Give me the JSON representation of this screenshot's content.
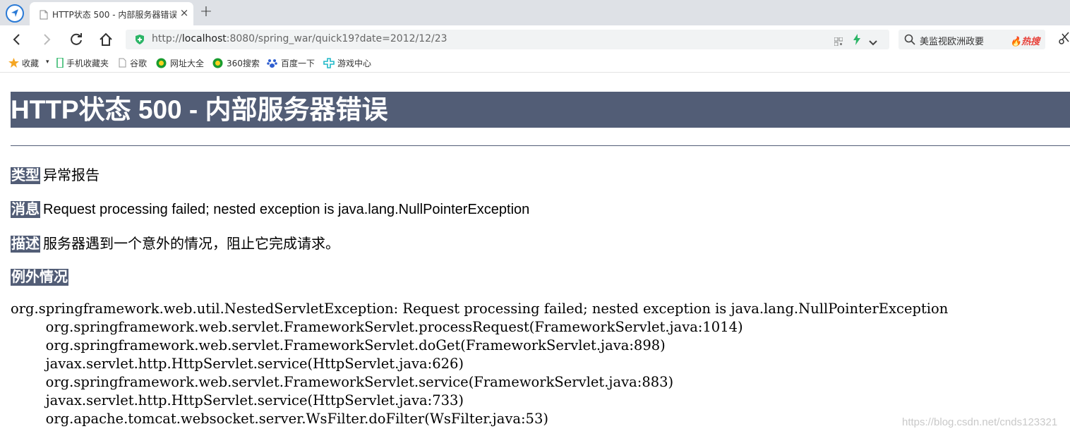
{
  "tab": {
    "title": "HTTP状态 500 - 内部服务器错误",
    "close": "×"
  },
  "new_tab": "+",
  "address": {
    "scheme": "http://",
    "host": "localhost",
    "rest": ":8080/spring_war/quick19?date=2012/12/23"
  },
  "search": {
    "text": "美监视欧洲政要",
    "hot": "🔥热搜"
  },
  "bookmarks": [
    {
      "label": "收藏",
      "icon": "star-icon"
    },
    {
      "label": "手机收藏夹",
      "icon": "phone-icon"
    },
    {
      "label": "谷歌",
      "icon": "doc-icon"
    },
    {
      "label": "网址大全",
      "icon": "360-icon"
    },
    {
      "label": "360搜索",
      "icon": "360-icon"
    },
    {
      "label": "百度一下",
      "icon": "baidu-paw-icon"
    },
    {
      "label": "游戏中心",
      "icon": "game-icon"
    }
  ],
  "page": {
    "heading": "HTTP状态 500 - 内部服务器错误",
    "type_label": "类型",
    "type_value": "异常报告",
    "message_label": "消息",
    "message_value": "Request processing failed; nested exception is java.lang.NullPointerException",
    "description_label": "描述",
    "description_value": "服务器遇到一个意外的情况，阻止它完成请求。",
    "exception_label": "例外情况",
    "stack_trace": [
      "org.springframework.web.util.NestedServletException: Request processing failed; nested exception is java.lang.NullPointerException",
      "\torg.springframework.web.servlet.FrameworkServlet.processRequest(FrameworkServlet.java:1014)",
      "\torg.springframework.web.servlet.FrameworkServlet.doGet(FrameworkServlet.java:898)",
      "\tjavax.servlet.http.HttpServlet.service(HttpServlet.java:626)",
      "\torg.springframework.web.servlet.FrameworkServlet.service(FrameworkServlet.java:883)",
      "\tjavax.servlet.http.HttpServlet.service(HttpServlet.java:733)",
      "\torg.apache.tomcat.websocket.server.WsFilter.doFilter(WsFilter.java:53)"
    ]
  },
  "watermark": "https://blog.csdn.net/cnds123321",
  "colors": {
    "header_bg": "#525d76",
    "tabbar_bg": "#dee1e6",
    "hot": "#e8423b"
  }
}
